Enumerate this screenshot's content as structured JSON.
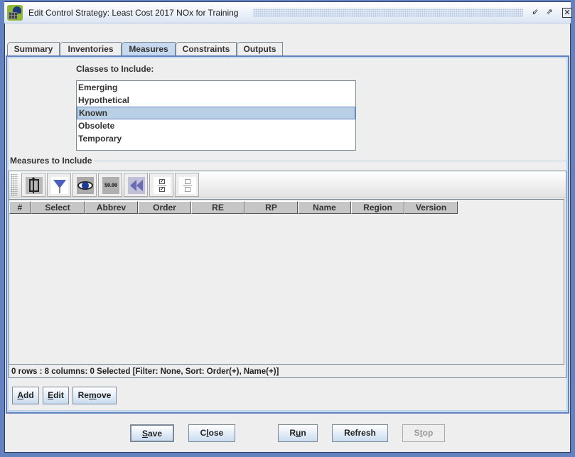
{
  "window": {
    "title": "Edit Control Strategy: Least Cost 2017 NOx for Training",
    "controls": [
      {
        "name": "minimize",
        "icon": "restore-down-icon",
        "glyph": "⇙"
      },
      {
        "name": "maximize",
        "icon": "maximize-icon",
        "glyph": "⇗"
      },
      {
        "name": "close",
        "icon": "close-icon",
        "glyph": "✕"
      }
    ]
  },
  "tabs": [
    {
      "label": "Summary",
      "active": false
    },
    {
      "label": "Inventories",
      "active": false
    },
    {
      "label": "Measures",
      "active": true
    },
    {
      "label": "Constraints",
      "active": false
    },
    {
      "label": "Outputs",
      "active": false
    }
  ],
  "classes": {
    "label": "Classes to Include:",
    "items": [
      {
        "label": "Emerging",
        "selected": false
      },
      {
        "label": "Hypothetical",
        "selected": false
      },
      {
        "label": "Known",
        "selected": true
      },
      {
        "label": "Obsolete",
        "selected": false
      },
      {
        "label": "Temporary",
        "selected": false
      }
    ]
  },
  "measures": {
    "group_title": "Measures to Include",
    "toolbar": [
      {
        "name": "sort-icon",
        "tooltip": "Sort"
      },
      {
        "name": "filter-icon",
        "tooltip": "Filter"
      },
      {
        "name": "view-icon",
        "tooltip": "View"
      },
      {
        "name": "format-icon",
        "tooltip": "Format",
        "text": "$0.00"
      },
      {
        "name": "reset-icon",
        "tooltip": "Reset"
      },
      {
        "name": "select-all-icon",
        "tooltip": "Select All"
      },
      {
        "name": "clear-all-icon",
        "tooltip": "Clear All"
      }
    ],
    "columns": [
      "#",
      "Select",
      "Abbrev",
      "Order",
      "RE",
      "RP",
      "Name",
      "Region",
      "Version"
    ],
    "rows": [],
    "status": "0 rows : 8 columns: 0 Selected [Filter: None, Sort: Order(+), Name(+)]",
    "buttons": [
      {
        "label": "Add",
        "mnemonic": "A"
      },
      {
        "label": "Edit",
        "mnemonic": "E"
      },
      {
        "label": "Remove",
        "mnemonic": "m"
      }
    ]
  },
  "footer": {
    "buttons": [
      {
        "label": "Save",
        "pre": "",
        "mn": "S",
        "post": "ave",
        "default": true,
        "enabled": true
      },
      {
        "label": "Close",
        "pre": "C",
        "mn": "l",
        "post": "ose",
        "enabled": true
      },
      {
        "label": "Run",
        "pre": "R",
        "mn": "u",
        "post": "n",
        "enabled": true
      },
      {
        "label": "Refresh",
        "pre": "Refresh",
        "mn": "",
        "post": "",
        "enabled": true
      },
      {
        "label": "Stop",
        "pre": "S",
        "mn": "t",
        "post": "op",
        "enabled": false
      }
    ]
  }
}
